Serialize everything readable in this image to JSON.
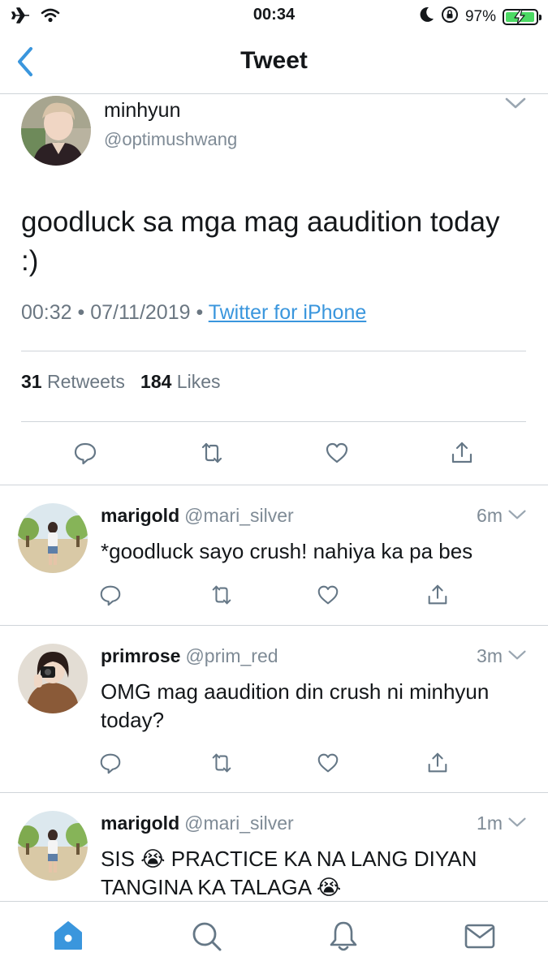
{
  "status_bar": {
    "time": "00:34",
    "battery_percent": "97%",
    "battery_level": 0.97,
    "icons": [
      "airplane-icon",
      "wifi-icon",
      "moon-icon",
      "rotation-lock-icon",
      "battery-icon"
    ]
  },
  "nav": {
    "title": "Tweet",
    "back_icon": "chevron-left-icon"
  },
  "main_tweet": {
    "name": "minhyun",
    "handle": "@optimushwang",
    "text": "goodluck sa mga mag aaudition today :)",
    "time": "00:32",
    "date": "07/11/2019",
    "separator": "•",
    "source": "Twitter for iPhone",
    "retweets_count": "31",
    "retweets_label": "Retweets",
    "likes_count": "184",
    "likes_label": "Likes"
  },
  "replies": [
    {
      "name": "marigold",
      "handle": "@mari_silver",
      "time": "6m",
      "text": "*goodluck sayo crush! nahiya ka pa bes"
    },
    {
      "name": "primrose",
      "handle": "@prim_red",
      "time": "3m",
      "text": "OMG mag aaudition din crush ni minhyun today?"
    },
    {
      "name": "marigold",
      "handle": "@mari_silver",
      "time": "1m",
      "text_line1": "SIS 😭  PRACTICE KA NA LANG DIYAN",
      "text_line2": "TANGINA KA TALAGA 😭"
    }
  ],
  "tab_bar": {
    "tabs": [
      "home-icon",
      "search-icon",
      "notifications-icon",
      "messages-icon"
    ],
    "active": "home-icon",
    "accent": "#3a96dd"
  },
  "colors": {
    "accent": "#3a96dd",
    "secondary_text": "#7f8b96",
    "divider": "#cfd4d9",
    "battery": "#4cd964"
  }
}
